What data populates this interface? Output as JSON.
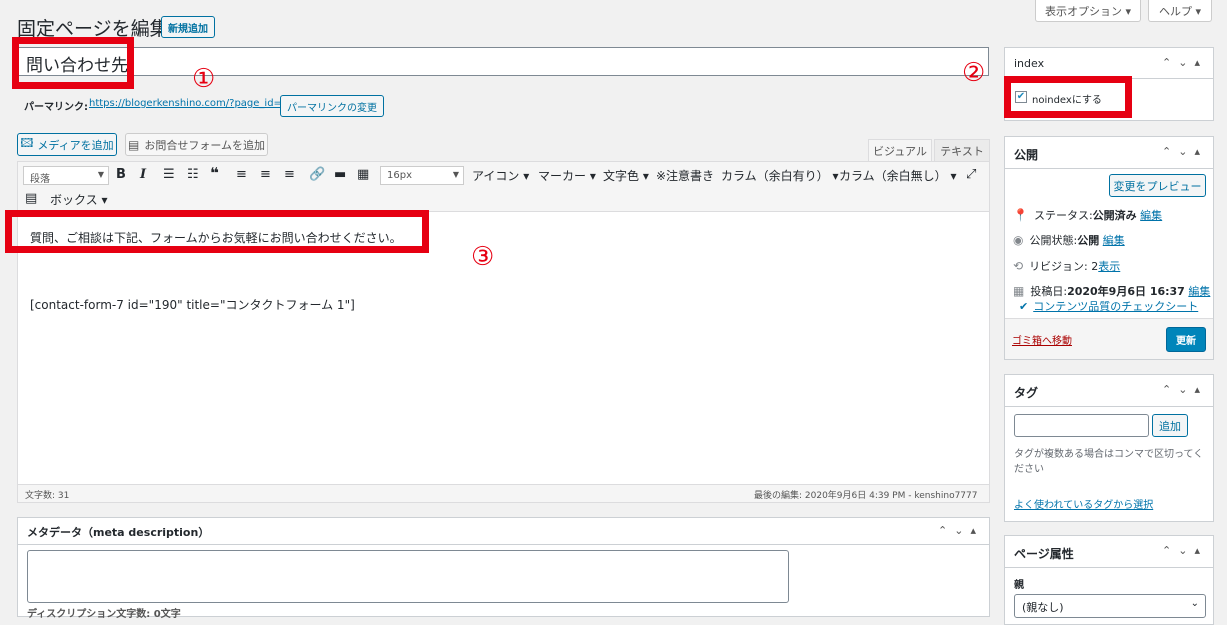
{
  "header": {
    "page_heading": "固定ページを編集",
    "add_new": "新規追加",
    "screen_options": "表示オプション ▾",
    "help": "ヘルプ ▾"
  },
  "post": {
    "title": "問い合わせ先",
    "permalink_label": "パーマリンク:",
    "permalink_url": "https://blogerkenshino.com/?page_id=191",
    "permalink_change": "パーマリンクの変更"
  },
  "annotations": {
    "one": "①",
    "two": "②",
    "three": "③"
  },
  "media": {
    "add_media": "メディアを追加",
    "add_form": "お問合せフォームを追加"
  },
  "editor_tabs": {
    "visual": "ビジュアル",
    "text": "テキスト"
  },
  "toolbar": {
    "format_select": "段落",
    "font_size": "16px",
    "icon": "アイコン ▾",
    "marker": "マーカー ▾",
    "text_color": "文字色 ▾",
    "note": "※注意書き",
    "column_margin": "カラム（余白有り） ▾",
    "column_nomargin": "カラム（余白無し） ▾",
    "box": "ボックス ▾"
  },
  "content": {
    "line1": "質問、ご相談は下記、フォームからお気軽にお問い合わせください。",
    "shortcode": "[contact-form-7 id=\"190\" title=\"コンタクトフォーム 1\"]"
  },
  "status_bar": {
    "word_count": "文字数: 31",
    "last_edit": "最後の編集: 2020年9月6日 4:39 PM - kenshino7777"
  },
  "meta": {
    "title": "メタデータ（meta description）",
    "desc_label": "ディスクリプション文字数: 0文字"
  },
  "index_box": {
    "title": "index",
    "noindex_label": "noindexにする",
    "checked": true
  },
  "publish_box": {
    "title": "公開",
    "preview": "変更をプレビュー",
    "status_label": "ステータス: ",
    "status_value": "公開済み",
    "visibility_label": "公開状態: ",
    "visibility_value": "公開",
    "revisions_label": "リビジョン: 2 ",
    "revisions_link": "表示",
    "published_label": "投稿日: ",
    "published_value": "2020年9月6日 16:37",
    "edit": "編集",
    "checklist": "コンテンツ品質のチェックシート",
    "trash": "ゴミ箱へ移動",
    "update": "更新"
  },
  "tags_box": {
    "title": "タグ",
    "add": "追加",
    "help": "タグが複数ある場合はコンマで区切ってください",
    "popular": "よく使われているタグから選択"
  },
  "page_attr_box": {
    "title": "ページ属性",
    "parent_label": "親",
    "parent_value": "(親なし)"
  },
  "colors": {
    "accent": "#0071a1",
    "primary_button": "#0085ba",
    "annotation_red": "#e60012",
    "trash_red": "#a00"
  }
}
